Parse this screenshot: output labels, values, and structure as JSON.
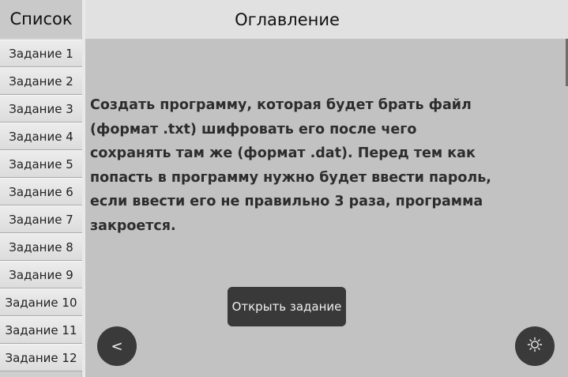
{
  "sidebar": {
    "title": "Список",
    "items": [
      {
        "label": "Задание 1"
      },
      {
        "label": "Задание 2"
      },
      {
        "label": "Задание 3"
      },
      {
        "label": "Задание 4"
      },
      {
        "label": "Задание 5"
      },
      {
        "label": "Задание 6"
      },
      {
        "label": "Задание 7"
      },
      {
        "label": "Задание 8"
      },
      {
        "label": "Задание 9"
      },
      {
        "label": "Задание 10"
      },
      {
        "label": "Задание 11"
      },
      {
        "label": "Задание 12"
      }
    ]
  },
  "header": {
    "title": "Оглавление"
  },
  "main": {
    "description": "Создать программу, которая будет брать файл (формат .txt) шифровать его после чего сохранять там же (формат .dat). Перед тем как попасть в программу нужно будет ввести пароль, если ввести его не правильно 3 раза, программа закроется.",
    "open_button_label": "Открыть задание",
    "back_button_label": "<",
    "theme_icon": "sun-icon"
  },
  "colors": {
    "background": "#c2c2c2",
    "button_dark": "#3a3a3a",
    "topbar": "#e1e1e1",
    "sidebar": "#cfcfcf"
  }
}
